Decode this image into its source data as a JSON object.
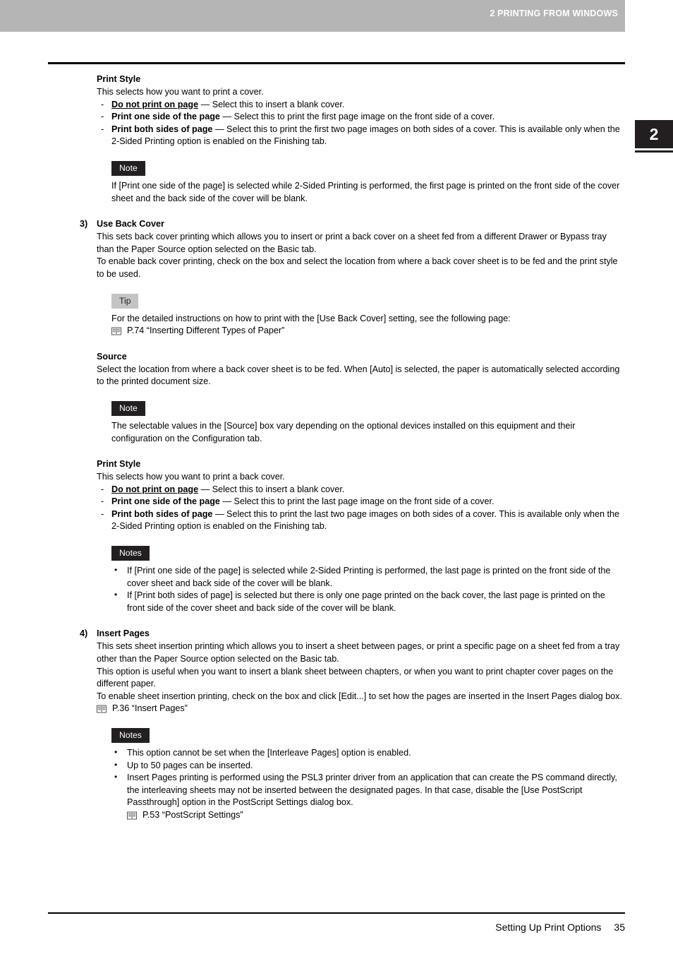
{
  "header": {
    "running_title": "2 PRINTING FROM WINDOWS",
    "chapter_tab_number": "2"
  },
  "colors": {
    "header_bar": "#b5b5b5",
    "note_label_bg": "#231f20",
    "note_label_text": "#ffffff",
    "tip_label_bg": "#c4c4c4",
    "tip_label_text": "#231f20",
    "chapter_tab_bg": "#231f20",
    "text": "#000000"
  },
  "icons": {
    "book": "book-icon",
    "dash": "-",
    "bullet": "•"
  },
  "sections": {
    "print_style_front": {
      "heading": "Print Style",
      "intro": "This selects how you want to print a cover.",
      "options": [
        {
          "term": "Do not print on page",
          "term_style": "bold-underline",
          "desc": " — Select this to insert a blank cover."
        },
        {
          "term": "Print one side of the page",
          "term_style": "bold",
          "desc": " — Select this to print the first page image on the front side of a cover."
        },
        {
          "term": "Print both sides of page",
          "term_style": "bold",
          "desc": " — Select this to print the first two page images on both sides of a cover. This is available only when the 2-Sided Printing option is enabled on the Finishing tab."
        }
      ],
      "note": {
        "label": "Note",
        "body": "If [Print one side of the page] is selected while 2-Sided Printing is performed, the first page is printed on the front side of the cover sheet and the back side of the cover will be blank."
      }
    },
    "use_back_cover": {
      "number": "3)",
      "title": "Use Back Cover",
      "paragraphs": [
        "This sets back cover printing which allows you to insert or print a back cover on a sheet fed from a different Drawer or Bypass tray than the Paper Source option selected on the Basic tab.",
        "To enable back cover printing, check on the box and select the location from where a back cover sheet is to be fed and the print style to be used."
      ],
      "tip": {
        "label": "Tip",
        "body": "For the detailed instructions on how to print with the [Use Back Cover] setting, see the following page:",
        "xref": "P.74 “Inserting Different Types of Paper”"
      }
    },
    "source": {
      "heading": "Source",
      "body": "Select the location from where a back cover sheet is to be fed.  When [Auto] is selected, the paper is automatically selected according to the printed document size.",
      "note": {
        "label": "Note",
        "body": "The selectable values in the [Source] box vary depending on the optional devices installed on this equipment and their configuration on the Configuration tab."
      }
    },
    "print_style_back": {
      "heading": "Print Style",
      "intro": "This selects how you want to print a back cover.",
      "options": [
        {
          "term": "Do not print on page",
          "term_style": "bold-underline",
          "desc": " — Select this to insert a blank cover."
        },
        {
          "term": "Print one side of the page",
          "term_style": "bold",
          "desc": " — Select this to print the last page image on the front side of a cover."
        },
        {
          "term": "Print both sides of page",
          "term_style": "bold",
          "desc": " — Select this to print the last two page images on both sides of a cover. This is available only when the 2-Sided Printing option is enabled on the Finishing tab."
        }
      ],
      "notes": {
        "label": "Notes",
        "items": [
          "If [Print one side of the page] is selected while 2-Sided Printing is performed, the last page is printed on the front side of the cover sheet and back side of the cover will be blank.",
          "If [Print both sides of page] is selected but there is only one page printed on the back cover, the last page is printed on the front side of the cover sheet and back side of the cover will be blank."
        ]
      }
    },
    "insert_pages": {
      "number": "4)",
      "title": "Insert Pages",
      "paragraphs": [
        "This sets sheet insertion printing which allows you to insert a sheet between pages, or print a specific page on a sheet fed from a tray other than the Paper Source option selected on the Basic tab.",
        "This option is useful when you want to insert a blank sheet between chapters, or when you want to print chapter cover pages on the different paper.",
        "To enable sheet insertion printing, check on the box and click [Edit...] to set how the pages are inserted in the Insert Pages dialog box."
      ],
      "xref": "P.36 “Insert Pages”",
      "notes": {
        "label": "Notes",
        "items": [
          "This option cannot be set when the [Interleave Pages] option is enabled.",
          "Up to 50 pages can be inserted.",
          "Insert Pages printing is performed using the PSL3 printer driver from an application that can create the PS command directly, the interleaving sheets may not be inserted between the designated pages. In that case, disable the [Use PostScript Passthrough] option in the PostScript Settings dialog box."
        ],
        "xref": "P.53 “PostScript Settings”"
      }
    }
  },
  "footer": {
    "title": "Setting Up Print Options",
    "page_number": "35"
  }
}
